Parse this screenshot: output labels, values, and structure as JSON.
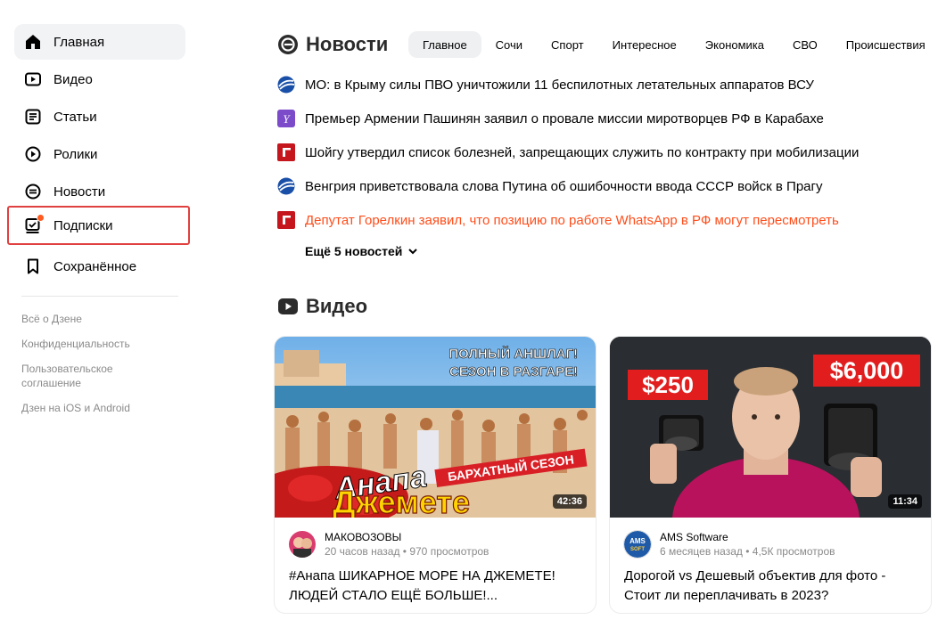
{
  "sidebar": {
    "items": [
      {
        "label": "Главная",
        "icon": "home-icon"
      },
      {
        "label": "Видео",
        "icon": "video-icon"
      },
      {
        "label": "Статьи",
        "icon": "articles-icon"
      },
      {
        "label": "Ролики",
        "icon": "clips-icon"
      },
      {
        "label": "Новости",
        "icon": "news-icon"
      },
      {
        "label": "Подписки",
        "icon": "subscriptions-icon"
      },
      {
        "label": "Сохранённое",
        "icon": "bookmark-icon"
      }
    ],
    "footer_links": [
      "Всё о Дзене",
      "Конфиденциальность",
      "Пользовательское соглашение",
      "Дзен на iOS и Android"
    ]
  },
  "news": {
    "title": "Новости",
    "tabs": [
      "Главное",
      "Сочи",
      "Спорт",
      "Интересное",
      "Экономика",
      "СВО",
      "Происшествия"
    ],
    "items": [
      {
        "text": "МО: в Крыму силы ПВО уничтожили 11 беспилотных летательных аппаратов ВСУ",
        "source_icon": "ria-globe-icon",
        "hot": false
      },
      {
        "text": "Премьер Армении Пашинян заявил о провале миссии миротворцев РФ в Карабахе",
        "source_icon": "yahoo-style-icon",
        "hot": false
      },
      {
        "text": "Шойгу утвердил список болезней, запрещающих служить по контракту при мобилизации",
        "source_icon": "gazeta-icon",
        "hot": false
      },
      {
        "text": "Венгрия приветствовала слова Путина об ошибочности ввода СССР войск в Прагу",
        "source_icon": "ria-globe-icon",
        "hot": false
      },
      {
        "text": "Депутат Горелкин заявил, что позицию по работе WhatsApp в РФ могут пересмотреть",
        "source_icon": "gazeta-icon",
        "hot": true
      }
    ],
    "more_label": "Ещё 5 новостей"
  },
  "videos": {
    "title": "Видео",
    "cards": [
      {
        "duration": "42:36",
        "channel": "МАКОВОЗОВЫ",
        "meta": "20 часов назад • 970 просмотров",
        "title": "#Анапа ШИКАРНОЕ МОРЕ НА ДЖЕМЕТЕ! ЛЮДЕЙ СТАЛО ЕЩЁ БОЛЬШЕ!...",
        "thumb_text_top": "ПОЛНЫЙ АНШЛАГ! СЕЗОН В РАЗГАРЕ!",
        "thumb_text_banner": "БАРХАТНЫЙ СЕЗОН",
        "thumb_text_big1": "Анапа",
        "thumb_text_big2": "Джемете"
      },
      {
        "duration": "11:34",
        "channel": "AMS Software",
        "meta": "6 месяцев назад • 4,5К просмотров",
        "title": "Дорогой vs Дешевый объектив для фото - Стоит ли переплачивать в 2023?",
        "price_left": "$250",
        "price_right": "$6,000",
        "avatar_text": "AMS SOFT"
      }
    ]
  },
  "colors": {
    "accent_red": "#e0403f",
    "hot_news": "#ff4d1a",
    "active_bg": "#f2f3f5"
  }
}
